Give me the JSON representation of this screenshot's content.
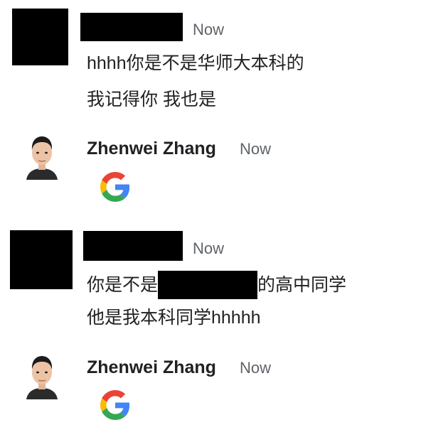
{
  "thread": [
    {
      "sender": "",
      "timestamp": "Now",
      "lines": [
        {
          "parts": [
            {
              "text": "hhhh你是不是华师大本科的"
            }
          ]
        },
        {
          "parts": [
            {
              "text": "我记得你 我也是"
            }
          ]
        }
      ]
    },
    {
      "sender": "Zhenwei Zhang",
      "timestamp": "Now",
      "attachment_icon": "google-g-icon"
    },
    {
      "sender": "",
      "timestamp": "Now",
      "lines": [
        {
          "before": "你是不是",
          "after": "的高中同学"
        },
        {
          "text": "他是我本科同学hhhhh"
        }
      ]
    },
    {
      "sender": "Zhenwei Zhang",
      "timestamp": "Now",
      "attachment_icon": "google-g-icon"
    }
  ],
  "colors": {
    "text": "#202124",
    "timestamp": "#5f6368",
    "redaction": "#000000",
    "google_blue": "#4285F4",
    "google_red": "#EA4335",
    "google_yellow": "#FBBC05",
    "google_green": "#34A853"
  }
}
